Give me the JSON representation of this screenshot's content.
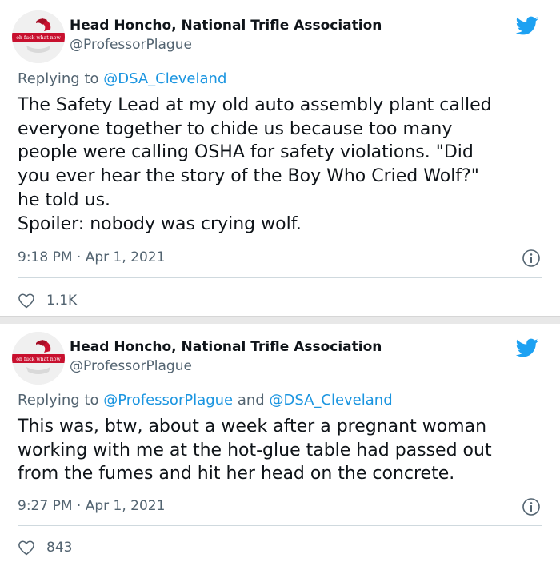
{
  "tweets": [
    {
      "author_name": "Head Honcho, National Trifle Association",
      "author_handle": "@ProfessorPlague",
      "avatar_text": "oh fuck what now",
      "replying_prefix": "Replying to ",
      "replying_to": [
        "@DSA_Cleveland"
      ],
      "replying_joiner": "",
      "body_lines": [
        "The Safety Lead at my old auto assembly plant called",
        "everyone together to chide us because too many",
        "people were calling OSHA for safety violations. \"Did",
        "you ever hear the story of the Boy Who Cried Wolf?\"",
        "he told us.",
        "Spoiler: nobody was crying wolf."
      ],
      "time": "9:18 PM · Apr 1, 2021",
      "likes": "1.1K"
    },
    {
      "author_name": "Head Honcho, National Trifle Association",
      "author_handle": "@ProfessorPlague",
      "avatar_text": "oh fuck what now",
      "replying_prefix": "Replying to ",
      "replying_to": [
        "@ProfessorPlague",
        "@DSA_Cleveland"
      ],
      "replying_joiner": " and ",
      "body_lines": [
        "This was, btw, about a week after a pregnant woman",
        "working with me at the hot-glue table had passed out",
        "from the fumes and hit her head on the concrete."
      ],
      "time": "9:27 PM · Apr 1, 2021",
      "likes": "843"
    }
  ],
  "icons": {
    "brand": "twitter-bird-icon",
    "info": "info-icon",
    "like": "heart-icon"
  },
  "colors": {
    "twitter_blue": "#1da1f2",
    "link_blue": "#1b95e0",
    "text_primary": "#0f1419",
    "text_secondary": "#536471",
    "avatar_red": "#c8102e"
  }
}
